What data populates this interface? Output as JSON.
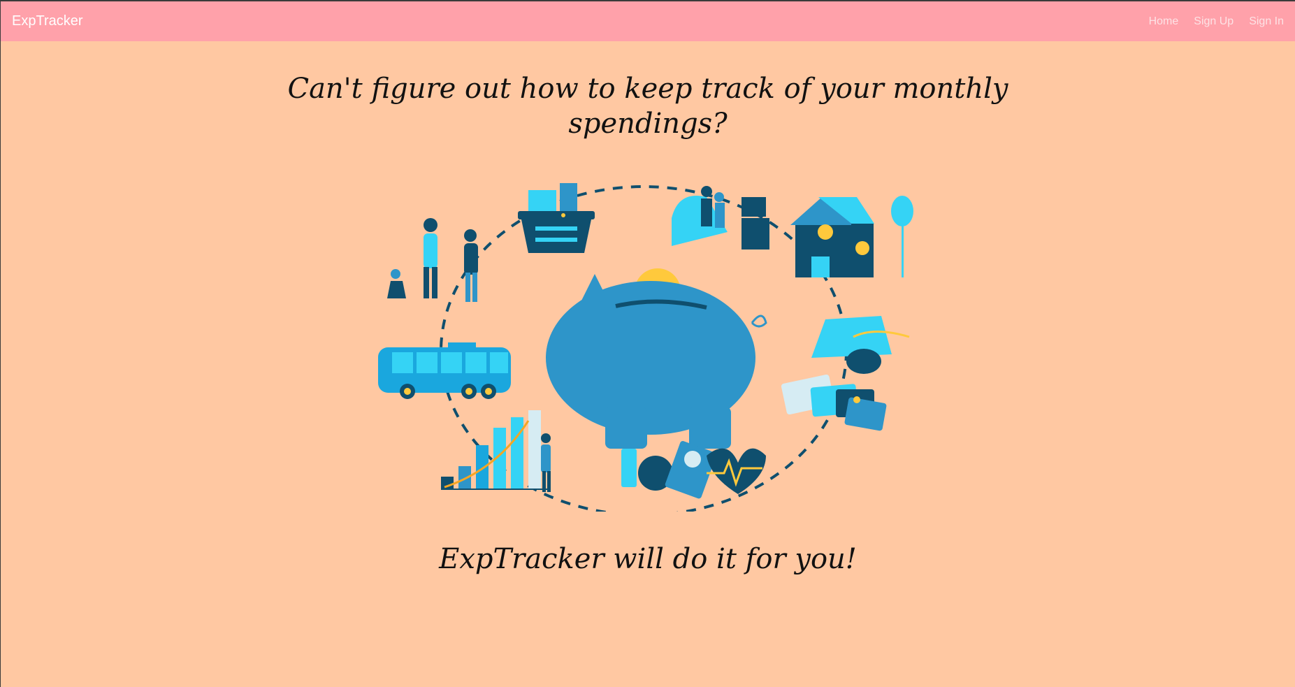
{
  "navbar": {
    "brand": "ExpTracker",
    "links": [
      "Home",
      "Sign Up",
      "Sign In"
    ]
  },
  "hero": {
    "headline_line1": "Can't figure out how to keep track of your monthly",
    "headline_line2": "spendings?",
    "tagline": "ExpTracker will do it for you!"
  },
  "colors": {
    "page_bg": "#ffc8a2",
    "navbar_bg": "#ffa1aa",
    "primary_blue": "#2e95c9",
    "light_blue": "#35d3f5",
    "dark_navy": "#0f4f6e",
    "accent_yellow": "#ffc93c"
  },
  "illustration": {
    "center": "piggy-bank-icon",
    "items": [
      "family-icon",
      "shopping-basket-icon",
      "living-room-icon",
      "house-icon",
      "graduation-cap-icon",
      "credit-cards-icon",
      "health-fitness-icon",
      "growth-chart-icon",
      "bus-icon"
    ]
  }
}
